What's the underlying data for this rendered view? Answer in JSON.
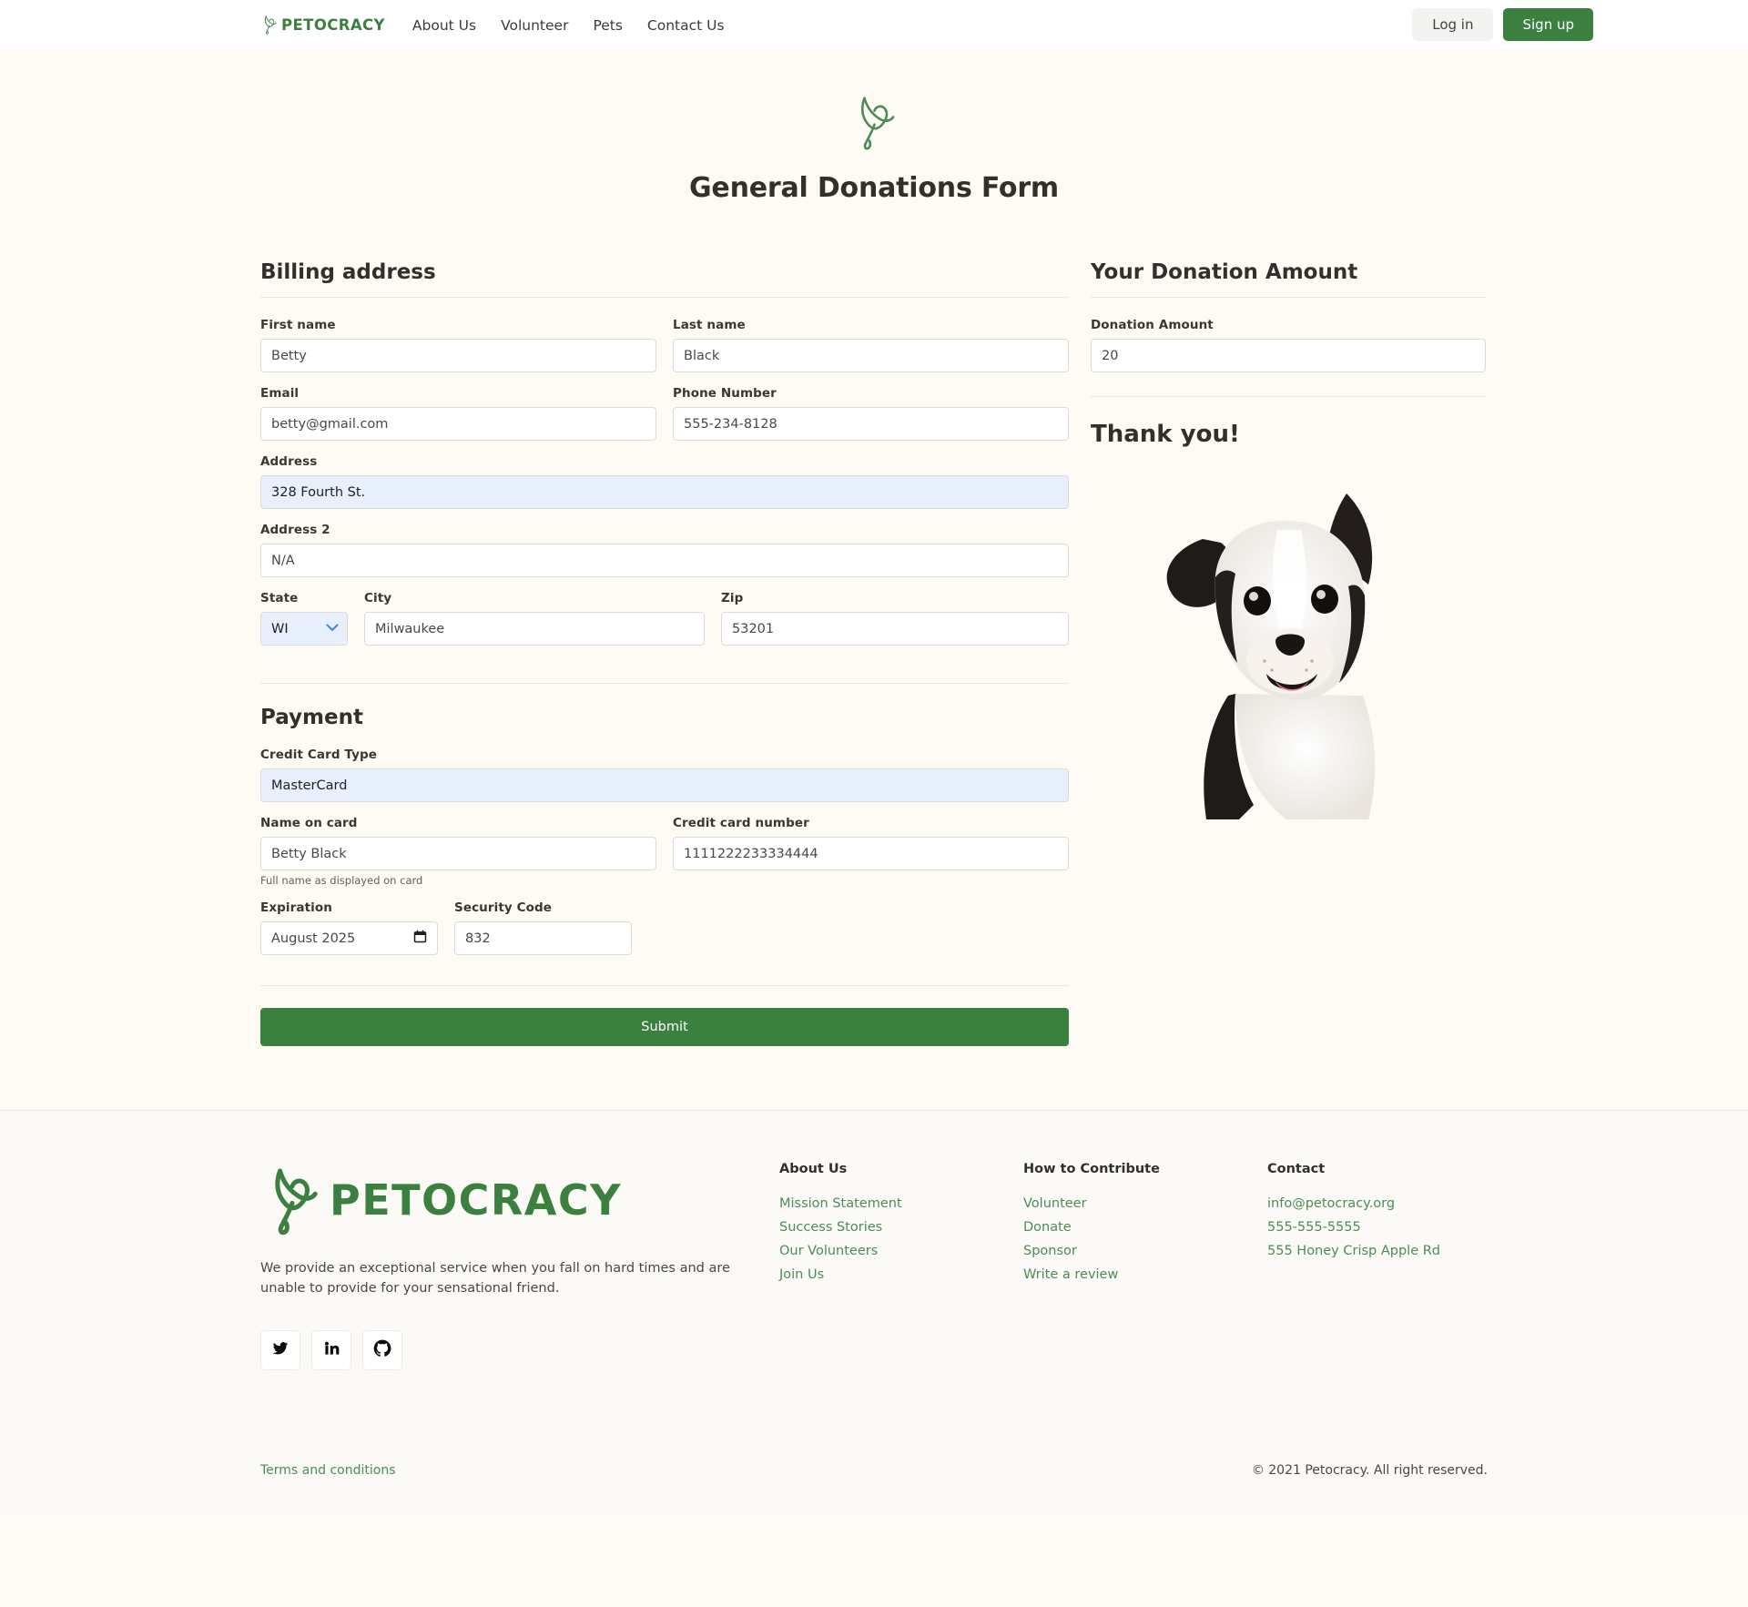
{
  "navbar": {
    "brand": "PETOCRACY",
    "brand_icon": "bird-logo-icon",
    "links": [
      {
        "label": "About Us"
      },
      {
        "label": "Volunteer"
      },
      {
        "label": "Pets"
      },
      {
        "label": "Contact Us"
      }
    ],
    "login_label": "Log in",
    "signup_label": "Sign up"
  },
  "hero": {
    "logo_icon": "bird-logo-icon",
    "title": "General Donations Form"
  },
  "billing": {
    "section_title": "Billing address",
    "first_name": {
      "label": "First name",
      "value": "Betty"
    },
    "last_name": {
      "label": "Last name",
      "value": "Black"
    },
    "email": {
      "label": "Email",
      "value": "betty@gmail.com"
    },
    "phone": {
      "label": "Phone Number",
      "value": "555-234-8128"
    },
    "address": {
      "label": "Address",
      "value": "328 Fourth St."
    },
    "address2": {
      "label": "Address 2",
      "value": "N/A"
    },
    "state": {
      "label": "State",
      "value": "WI",
      "icon": "chevron-down-icon"
    },
    "city": {
      "label": "City",
      "value": "Milwaukee"
    },
    "zip": {
      "label": "Zip",
      "value": "53201"
    }
  },
  "payment": {
    "section_title": "Payment",
    "card_type": {
      "label": "Credit Card Type",
      "value": "MasterCard"
    },
    "name_on_card": {
      "label": "Name on card",
      "value": "Betty Black",
      "helper": "Full name as displayed on card"
    },
    "card_number": {
      "label": "Credit card number",
      "value": "1111222233334444"
    },
    "expiration": {
      "label": "Expiration",
      "value": "August 2025",
      "icon": "calendar-icon"
    },
    "security_code": {
      "label": "Security Code",
      "value": "832"
    },
    "submit_label": "Submit"
  },
  "donation": {
    "section_title": "Your Donation Amount",
    "amount": {
      "label": "Donation Amount",
      "value": "20"
    },
    "thanks_title": "Thank you!",
    "image_alt": "boston-terrier-dog-photo"
  },
  "footer": {
    "brand": "PETOCRACY",
    "brand_icon": "bird-logo-icon",
    "description": "We provide an exceptional service when you fall on hard times and are unable to provide for your sensational friend.",
    "socials": [
      {
        "name": "twitter-icon",
        "label": "Twitter"
      },
      {
        "name": "linkedin-icon",
        "label": "LinkedIn"
      },
      {
        "name": "github-icon",
        "label": "GitHub"
      }
    ],
    "columns": [
      {
        "heading": "About Us",
        "links": [
          "Mission Statement",
          "Success Stories",
          "Our Volunteers",
          "Join Us"
        ]
      },
      {
        "heading": "How to Contribute",
        "links": [
          "Volunteer",
          "Donate",
          "Sponsor",
          "Write a review"
        ]
      },
      {
        "heading": "Contact",
        "links": [
          "info@petocracy.org",
          "555-555-5555",
          "555 Honey Crisp Apple Rd"
        ]
      }
    ],
    "terms": "Terms and conditions",
    "copyright": "© 2021 Petocracy. All right reserved."
  },
  "colors": {
    "brand_green": "#3c8040",
    "link_green": "#4c8c56",
    "page_bg": "#fdfbf4",
    "autofill_blue": "#e8f0fe",
    "chevron_blue": "#4285f4"
  }
}
